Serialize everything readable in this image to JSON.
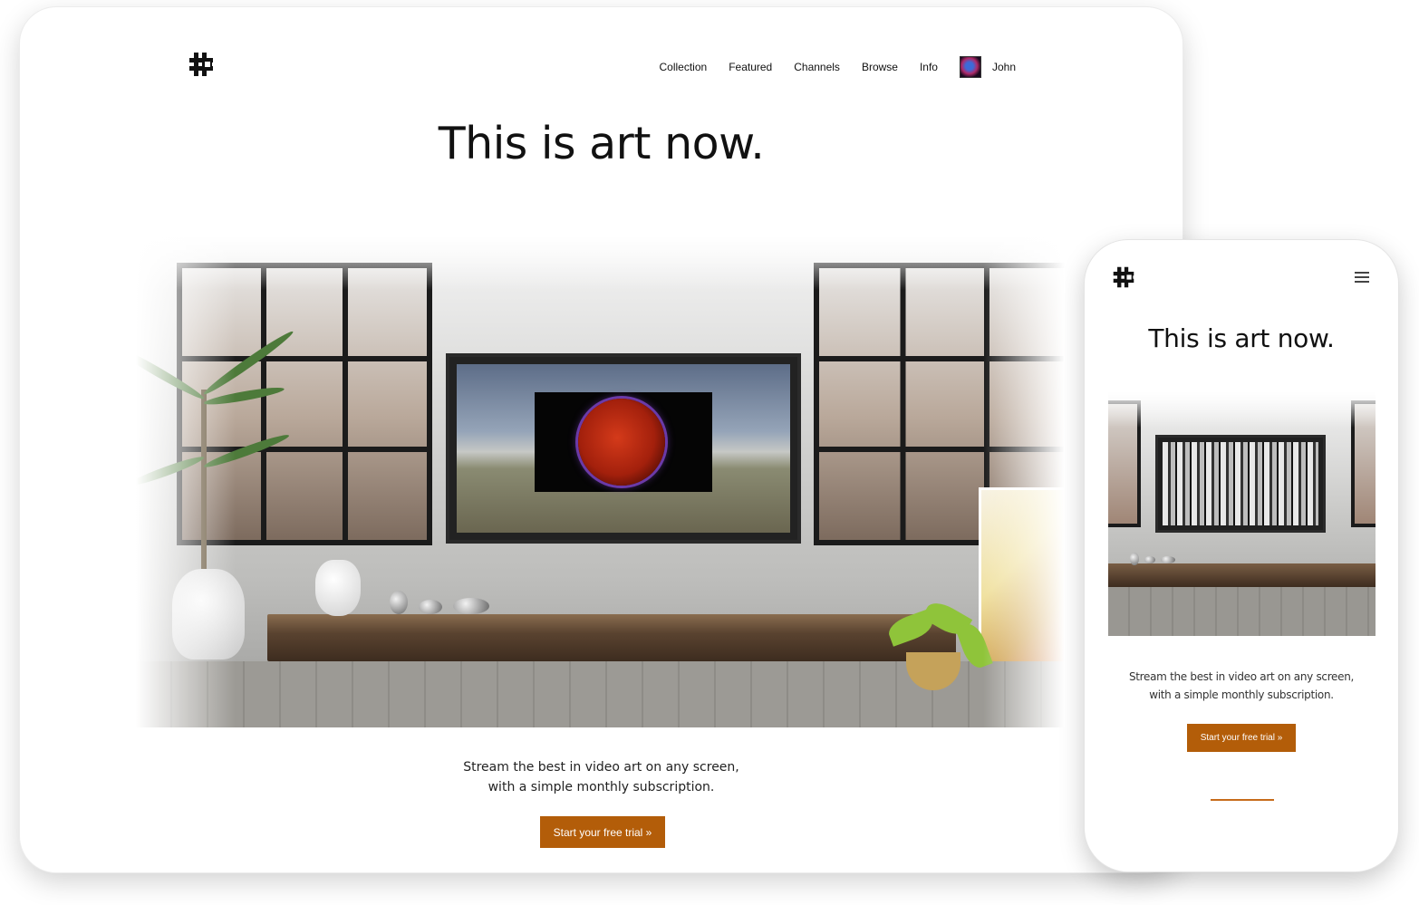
{
  "desktop": {
    "logo_icon": "puzzle-hash-logo",
    "nav": {
      "items": [
        {
          "label": "Collection"
        },
        {
          "label": "Featured"
        },
        {
          "label": "Channels"
        },
        {
          "label": "Browse"
        },
        {
          "label": "Info"
        }
      ],
      "user_name": "John"
    },
    "hero_title": "This is art now.",
    "tagline_line1": "Stream the best in video art on any screen,",
    "tagline_line2": "with a simple monthly subscription.",
    "cta_label": "Start your free trial »"
  },
  "mobile": {
    "logo_icon": "puzzle-hash-logo",
    "menu_icon": "hamburger-icon",
    "hero_title": "This is art now.",
    "tagline_line1": "Stream the best in video art on any screen,",
    "tagline_line2": "with a simple monthly subscription.",
    "cta_label": "Start your free trial »"
  },
  "colors": {
    "accent": "#b35d09",
    "text": "#111111",
    "background": "#ffffff"
  }
}
